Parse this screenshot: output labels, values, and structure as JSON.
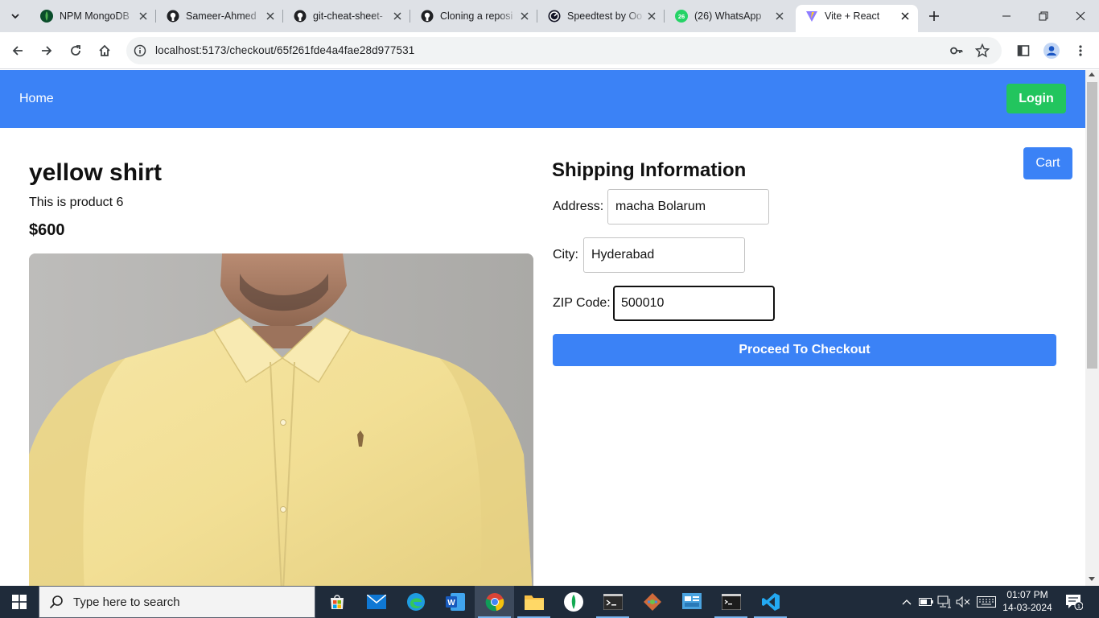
{
  "browser": {
    "tabs": [
      {
        "title": "NPM MongoDB",
        "icon": "mongodb-leaf-icon"
      },
      {
        "title": "Sameer-Ahmed",
        "icon": "github-icon"
      },
      {
        "title": "git-cheat-sheet-",
        "icon": "github-icon"
      },
      {
        "title": "Cloning a reposi",
        "icon": "github-icon"
      },
      {
        "title": "Speedtest by Oo",
        "icon": "speedtest-icon"
      },
      {
        "title": "(26) WhatsApp",
        "icon": "whatsapp-icon"
      },
      {
        "title": "Vite + React",
        "icon": "vite-icon",
        "active": true
      }
    ],
    "url": "localhost:5173/checkout/65f261fde4a4fae28d977531",
    "whatsapp_badge": "26"
  },
  "page": {
    "nav": {
      "home": "Home",
      "login": "Login"
    },
    "product": {
      "title": "yellow shirt",
      "description": "This is product 6",
      "price": "$600",
      "image_alt": "yellow shirt"
    },
    "shipping": {
      "title": "Shipping Information",
      "address_label": "Address:",
      "address_value": "macha Bolarum",
      "city_label": "City:",
      "city_value": "Hyderabad",
      "zip_label": "ZIP Code:",
      "zip_value": "500010",
      "checkout_button": "Proceed To Checkout"
    },
    "cart_button": "Cart",
    "colors": {
      "nav": "#3b82f6",
      "login": "#22c55e",
      "button": "#3b82f6"
    }
  },
  "taskbar": {
    "search_placeholder": "Type here to search",
    "time": "01:07 PM",
    "date": "14-03-2024"
  }
}
